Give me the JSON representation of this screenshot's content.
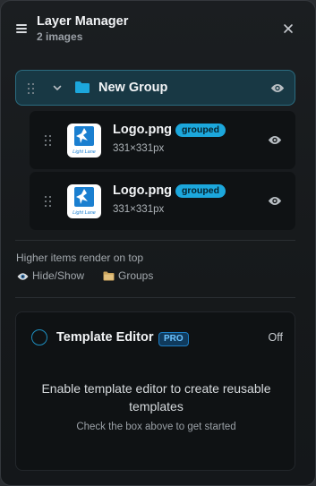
{
  "header": {
    "title": "Layer Manager",
    "subtitle": "2 images"
  },
  "group": {
    "label": "New Group",
    "color": "#1ca7dc"
  },
  "items": [
    {
      "filename": "Logo.png",
      "badge": "grouped",
      "dims": "331×331px",
      "logo_text": "Light Lane"
    },
    {
      "filename": "Logo.png",
      "badge": "grouped",
      "dims": "331×331px",
      "logo_text": "Light Lane"
    }
  ],
  "hints": {
    "order": "Higher items render on top",
    "hide_show": "Hide/Show",
    "groups": "Groups"
  },
  "template": {
    "title": "Template Editor",
    "pro_badge": "PRO",
    "status": "Off",
    "description": "Enable template editor to create reusable templates",
    "instruction": "Check the box above to get started"
  },
  "colors": {
    "accent": "#1ca7dc",
    "panel_bg": "#1b1e21",
    "group_bg": "#183844",
    "item_bg": "#0f1214"
  },
  "icons": [
    "menu-icon",
    "close-icon",
    "drag-handle-icon",
    "chevron-down-icon",
    "folder-icon",
    "eye-icon",
    "folder-small-icon"
  ]
}
